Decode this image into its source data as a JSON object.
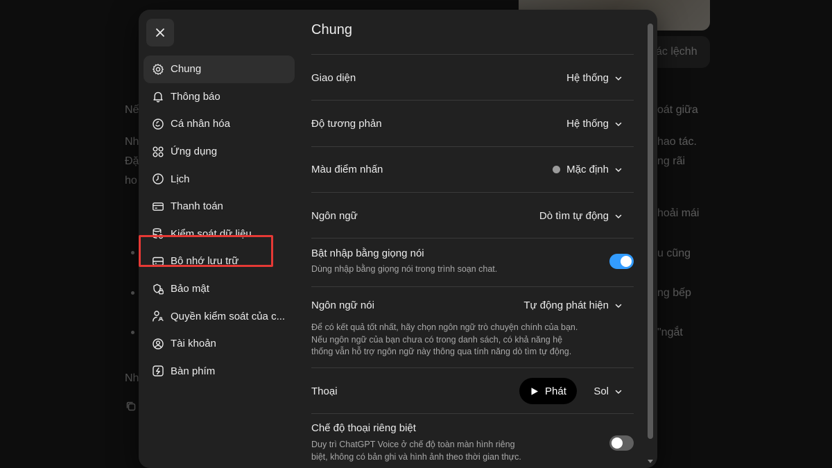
{
  "background": {
    "pill_text": "ác lệchh",
    "fragments": [
      "Nế",
      "Nh",
      "Đặ",
      "ho",
      "Nh",
      "oát giữa",
      "hao tác.",
      "ng rãi",
      "hoải mái",
      "u cũng",
      "ng bếp",
      "\"ngắt"
    ]
  },
  "close_button": {
    "icon": "close-icon"
  },
  "sidebar": {
    "items": [
      {
        "label": "Chung",
        "icon": "gear-icon",
        "active": true
      },
      {
        "label": "Thông báo",
        "icon": "bell-icon"
      },
      {
        "label": "Cá nhân hóa",
        "icon": "personalize-icon"
      },
      {
        "label": "Ứng dụng",
        "icon": "apps-grid-icon"
      },
      {
        "label": "Lịch",
        "icon": "clock-icon"
      },
      {
        "label": "Thanh toán",
        "icon": "credit-card-icon"
      },
      {
        "label": "Kiểm soát dữ liệu",
        "icon": "database-settings-icon"
      },
      {
        "label": "Bộ nhớ lưu trữ",
        "icon": "storage-icon"
      },
      {
        "label": "Bảo mật",
        "icon": "security-icon"
      },
      {
        "label": "Quyền kiểm soát của c...",
        "icon": "parental-controls-icon"
      },
      {
        "label": "Tài khoản",
        "icon": "account-icon"
      },
      {
        "label": "Bàn phím",
        "icon": "keyboard-icon"
      }
    ],
    "highlighted_item": "Thanh toán",
    "highlight_color": "#e53935"
  },
  "content": {
    "title": "Chung",
    "settings": {
      "appearance": {
        "label": "Giao diện",
        "value": "Hệ thống"
      },
      "contrast": {
        "label": "Độ tương phản",
        "value": "Hệ thống"
      },
      "accent": {
        "label": "Màu điểm nhấn",
        "value": "Mặc định",
        "swatch_color": "#9b9b9b"
      },
      "language": {
        "label": "Ngôn ngữ",
        "value": "Dò tìm tự động"
      },
      "voice_input": {
        "label": "Bật nhập bằng giọng nói",
        "description": "Dùng nhập bằng giọng nói trong trình soạn chat.",
        "enabled": true
      },
      "spoken_language": {
        "label": "Ngôn ngữ nói",
        "value": "Tự động phát hiện",
        "description_lines": [
          "Để có kết quả tốt nhất, hãy chọn ngôn ngữ trò chuyện chính của bạn.",
          "Nếu ngôn ngữ của bạn chưa có trong danh sách, có khả năng hệ",
          "thống vẫn hỗ trợ ngôn ngữ này thông qua tính năng dò tìm tự động."
        ]
      },
      "voice": {
        "label": "Thoại",
        "play_label": "Phát",
        "value": "Sol"
      },
      "separate_voice_mode": {
        "label": "Chế độ thoại riêng biệt",
        "description_lines": [
          "Duy trì ChatGPT Voice ở chế độ toàn màn hình riêng",
          "biệt, không có bản ghi và hình ảnh theo thời gian thực."
        ],
        "enabled": false
      }
    }
  },
  "colors": {
    "modal_bg": "#212121",
    "active_nav_bg": "#2f2f2f",
    "toggle_on": "#339cff",
    "toggle_off": "#606060"
  }
}
